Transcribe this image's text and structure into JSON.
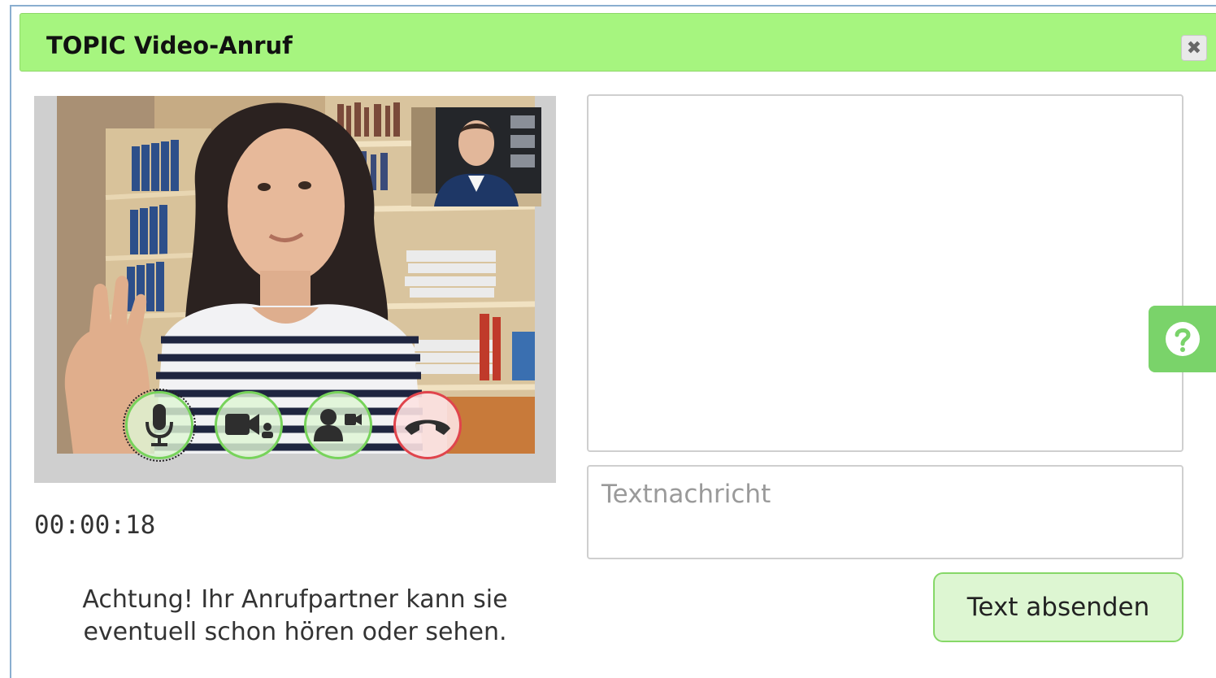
{
  "dialog": {
    "title": "TOPIC Video-Anruf",
    "close_icon": "close-icon"
  },
  "video": {
    "remote_video": "remote-participant-video",
    "self_video": "self-preview-video",
    "controls": [
      {
        "name": "mute-microphone-button",
        "icon": "microphone-icon",
        "style": "green"
      },
      {
        "name": "toggle-camera-button",
        "icon": "video-camera-icon",
        "style": "green"
      },
      {
        "name": "switch-camera-button",
        "icon": "person-camera-icon",
        "style": "green"
      },
      {
        "name": "hang-up-button",
        "icon": "phone-hangup-icon",
        "style": "red"
      }
    ],
    "timer": "00:00:18",
    "warning": "Achtung! Ihr Anrufpartner kann sie eventuell schon hören oder sehen."
  },
  "chat": {
    "input_placeholder": "Textnachricht",
    "send_label": "Text absenden"
  },
  "help": {
    "icon": "help-icon"
  },
  "colors": {
    "titlebar": "#a6f57f",
    "accent_green": "#77d35b",
    "hangup_red": "#e0444c",
    "help_tab": "#7ad36a"
  }
}
